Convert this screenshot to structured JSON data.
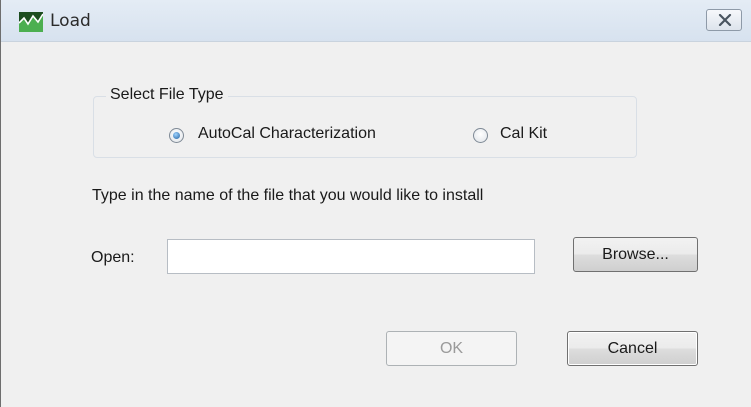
{
  "window": {
    "title": "Load",
    "app_icon": "chart-app-icon",
    "close_icon": "close-x-icon"
  },
  "file_type": {
    "label": "Select File Type",
    "options": [
      {
        "label": "AutoCal Characterization",
        "selected": true
      },
      {
        "label": "Cal Kit",
        "selected": false
      }
    ]
  },
  "instruction": "Type in the name of the file that you would like to install",
  "open": {
    "label": "Open:",
    "value": "",
    "placeholder": ""
  },
  "buttons": {
    "browse": "Browse...",
    "ok": "OK",
    "ok_enabled": false,
    "cancel": "Cancel"
  },
  "colors": {
    "dialog_bg": "#f0f0f0",
    "titlebar": "#dfe8f2",
    "radio_accent": "#1f5f9e"
  }
}
